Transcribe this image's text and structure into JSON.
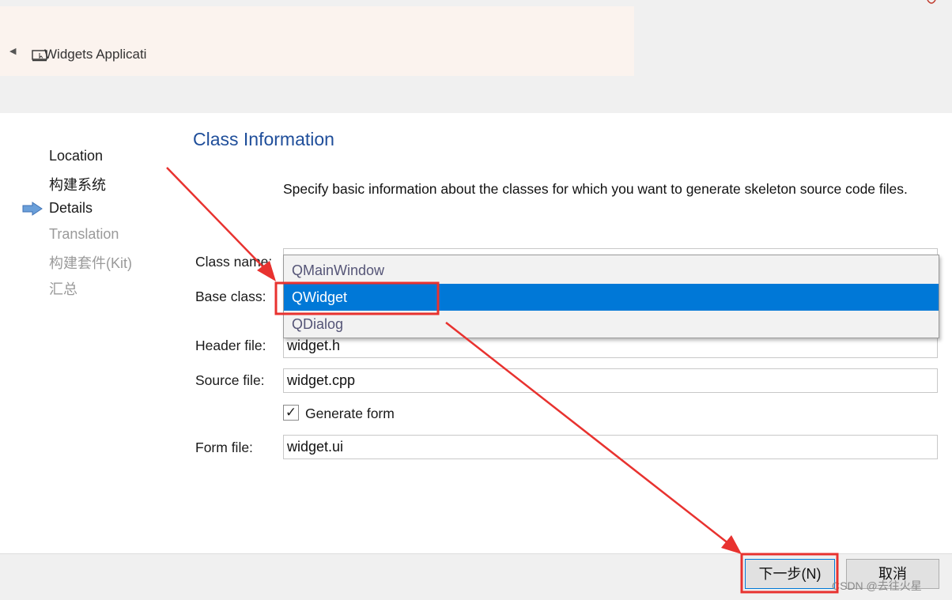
{
  "header": {
    "breadcrumb": "Widgets Applicati"
  },
  "steps": [
    {
      "label": "Location"
    },
    {
      "label": "构建系统"
    },
    {
      "label": "Details"
    },
    {
      "label": "Translation"
    },
    {
      "label": "构建套件(Kit)"
    },
    {
      "label": "汇总"
    }
  ],
  "current_step": "Details",
  "page": {
    "title": "Class Information",
    "description": "Specify basic information about the classes for which you want to generate skeleton source code files."
  },
  "form": {
    "class_name_label": "Class name:",
    "base_class_label": "Base class:",
    "header_file_label": "Header file:",
    "header_file_value": "widget.h",
    "source_file_label": "Source file:",
    "source_file_value": "widget.cpp",
    "generate_form_label": "Generate form",
    "generate_form_checked": true,
    "check_glyph": "✓",
    "form_file_label": "Form file:",
    "form_file_value": "widget.ui"
  },
  "dropdown": {
    "options": [
      "QMainWindow",
      "QWidget",
      "QDialog"
    ],
    "selected": "QWidget"
  },
  "buttons": {
    "next_label": "下一步(N)",
    "cancel_label": "取消"
  },
  "watermark": "CSDN @去往火星",
  "colors": {
    "selection": "#0078d7",
    "title": "#1f4e9a",
    "annotation": "#e8322f"
  }
}
